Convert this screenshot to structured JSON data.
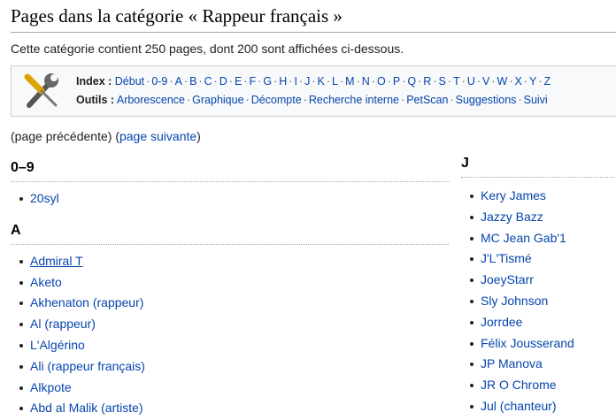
{
  "page_title": "Pages dans la catégorie « Rappeur français »",
  "intro": "Cette catégorie contient 250 pages, dont 200 sont affichées ci-dessous.",
  "index": {
    "label": "Index :",
    "links": [
      "Début",
      "0-9",
      "A",
      "B",
      "C",
      "D",
      "E",
      "F",
      "G",
      "H",
      "I",
      "J",
      "K",
      "L",
      "M",
      "N",
      "O",
      "P",
      "Q",
      "R",
      "S",
      "T",
      "U",
      "V",
      "W",
      "X",
      "Y",
      "Z"
    ]
  },
  "tools": {
    "label": "Outils :",
    "links": [
      "Arborescence",
      "Graphique",
      "Décompte",
      "Recherche interne",
      "PetScan",
      "Suggestions",
      "Suivi"
    ]
  },
  "pager": {
    "prev": "(page précédente)",
    "open": "(",
    "next": "page suivante",
    "close": ")"
  },
  "groups": {
    "g09": {
      "heading": "0–9",
      "items": [
        "20syl"
      ]
    },
    "ga": {
      "heading": "A",
      "items": [
        "Admiral T",
        "Aketo",
        "Akhenaton (rappeur)",
        "Al (rappeur)",
        "L'Algérino",
        "Ali (rappeur français)",
        "Alkpote",
        "Abd al Malik (artiste)"
      ]
    },
    "gj": {
      "heading": "J",
      "items": [
        "Kery James",
        "Jazzy Bazz",
        "MC Jean Gab'1",
        "J'L'Tismé",
        "JoeyStarr",
        "Sly Johnson",
        "Jorrdee",
        "Félix Jousserand",
        "JP Manova",
        "JR O Chrome",
        "Jul (chanteur)"
      ]
    }
  },
  "colors": {
    "link": "#0645ad",
    "text": "#202122",
    "navbox_bg": "#f8f9fa"
  },
  "icons": {
    "tools": "wrench-screwdriver-icon"
  }
}
